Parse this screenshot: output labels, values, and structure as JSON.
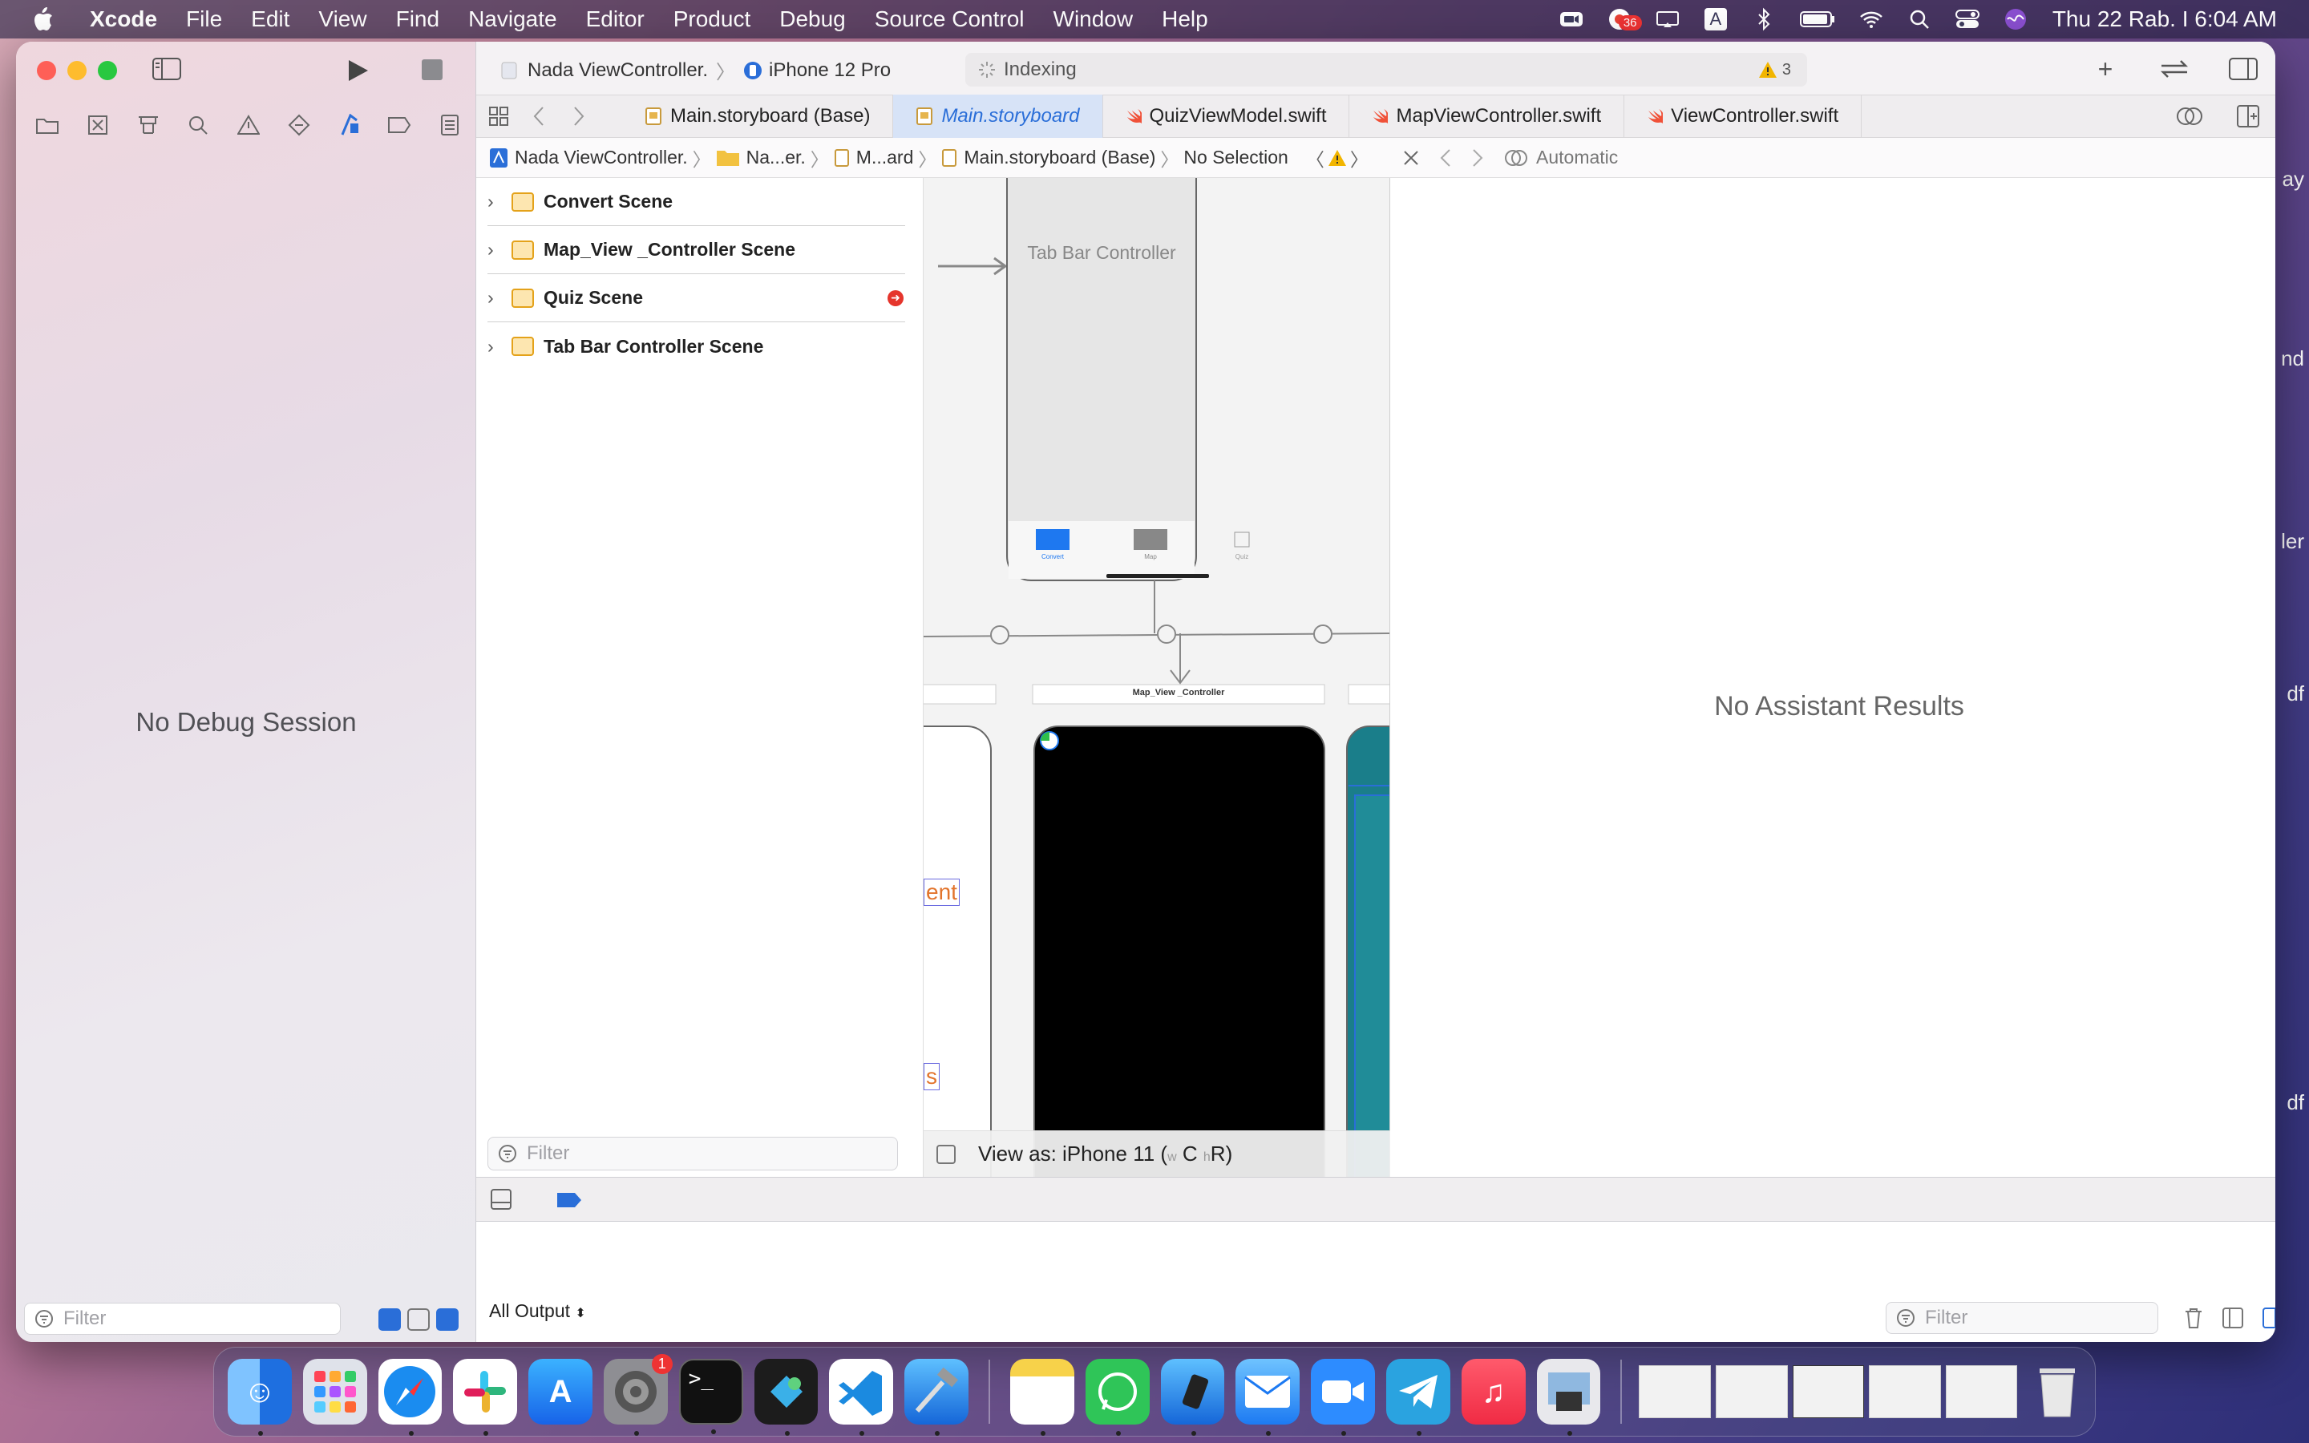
{
  "menubar": {
    "app_name": "Xcode",
    "menus": [
      "File",
      "Edit",
      "View",
      "Find",
      "Navigate",
      "Editor",
      "Product",
      "Debug",
      "Source Control",
      "Window",
      "Help"
    ],
    "notification_badge": "36",
    "clock": "Thu 22 Rab. I  6:04 AM",
    "keyboard_letter": "A"
  },
  "window": {
    "scheme": "Nada ViewController.",
    "device": "iPhone 12 Pro",
    "activity_status": "Indexing",
    "warning_count": "3"
  },
  "tabs": [
    {
      "label": "Main.storyboard (Base)",
      "icon": "storyboard-icon"
    },
    {
      "label": "Main.storyboard",
      "icon": "storyboard-icon",
      "active": true
    },
    {
      "label": "QuizViewModel.swift",
      "icon": "swift-icon"
    },
    {
      "label": "MapViewController.swift",
      "icon": "swift-icon"
    },
    {
      "label": "ViewController.swift",
      "icon": "swift-icon"
    }
  ],
  "jumpbar": {
    "crumbs": [
      "Nada ViewController.",
      "Na...er.",
      "M...ard",
      "Main.storyboard (Base)",
      "No Selection"
    ]
  },
  "outline": {
    "scenes": [
      {
        "label": "Convert Scene",
        "error": false
      },
      {
        "label": "Map_View _Controller Scene",
        "error": false
      },
      {
        "label": "Quiz Scene",
        "error": true
      },
      {
        "label": "Tab Bar Controller Scene",
        "error": false
      }
    ],
    "filter_placeholder": "Filter"
  },
  "canvas": {
    "tab_bar_controller_title": "Tab Bar Controller",
    "tab_items": [
      "Convert",
      "Map",
      "Quiz"
    ],
    "map_controller_label": "Map_View _Controller",
    "left_partial_text_1": "ent",
    "left_partial_text_2": "s",
    "view_as_label": "View as: iPhone 11 (",
    "view_as_w": "w",
    "view_as_c": "C",
    "view_as_h": "h",
    "view_as_r": "R)"
  },
  "assistant": {
    "mode": "Automatic",
    "no_results": "No Assistant Results"
  },
  "debug": {
    "no_session": "No Debug Session",
    "output_selector": "All Output",
    "filter_placeholder": "Filter",
    "left_filter_placeholder": "Filter"
  },
  "dock": {
    "apps": [
      "Finder",
      "Launchpad",
      "Safari",
      "Slack",
      "App Store",
      "System Preferences",
      "Terminal",
      "Xcode Helper",
      "Visual Studio Code",
      "Xcode",
      "Notes",
      "WhatsApp",
      "Simulator",
      "Mail",
      "Zoom",
      "Telegram",
      "Music",
      "Preview"
    ],
    "system_prefs_badge": "1"
  },
  "desktop_edge": [
    "ay",
    "nd",
    "ler",
    "df",
    "df"
  ],
  "colors": {
    "accent": "#2a6ed8",
    "error": "#e5352c",
    "warning": "#f2b500"
  }
}
